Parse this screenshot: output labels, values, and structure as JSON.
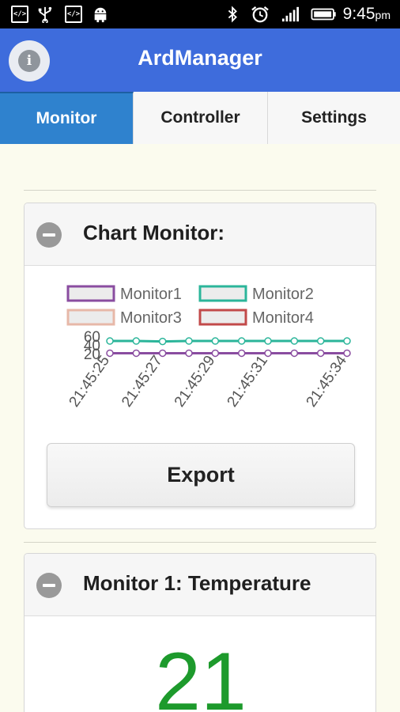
{
  "status_bar": {
    "time": "9:45",
    "ampm": "pm",
    "left_icons": [
      "code-icon",
      "usb-icon",
      "code-icon",
      "android-icon"
    ],
    "right_icons": [
      "bluetooth-icon",
      "alarm-icon",
      "signal-icon",
      "battery-icon"
    ]
  },
  "app_bar": {
    "title": "ArdManager",
    "info_glyph": "i",
    "color": "#3e6cdc"
  },
  "tabs": [
    {
      "label": "Monitor",
      "active": true
    },
    {
      "label": "Controller",
      "active": false
    },
    {
      "label": "Settings",
      "active": false
    }
  ],
  "chart_card": {
    "title": "Chart Monitor:",
    "export_label": "Export"
  },
  "chart_data": {
    "type": "line",
    "legend": [
      {
        "name": "Monitor1",
        "color": "#8a4da0"
      },
      {
        "name": "Monitor2",
        "color": "#2bb59a"
      },
      {
        "name": "Monitor3",
        "color": "#e7b8a8"
      },
      {
        "name": "Monitor4",
        "color": "#c24a4a"
      }
    ],
    "y_ticks": [
      "60",
      "40",
      "20"
    ],
    "x_labels": [
      "21:45:25",
      "21:45:27",
      "21:45:29",
      "21:45:31",
      "21:45:34"
    ],
    "x": [
      "21:45:25",
      "21:45:26",
      "21:45:27",
      "21:45:28",
      "21:45:29",
      "21:45:30",
      "21:45:31",
      "21:45:32",
      "21:45:33",
      "21:45:34"
    ],
    "ylim": [
      20,
      60
    ],
    "series": [
      {
        "name": "Monitor1",
        "values": [
          21,
          21,
          21,
          21,
          21,
          21,
          21,
          21,
          21,
          21
        ]
      },
      {
        "name": "Monitor2",
        "values": [
          49,
          49,
          48,
          49,
          49,
          49,
          49,
          49,
          49,
          49
        ]
      }
    ]
  },
  "monitor1_card": {
    "title": "Monitor 1: Temperature",
    "value": "21",
    "value_color": "#1d9a2c"
  }
}
